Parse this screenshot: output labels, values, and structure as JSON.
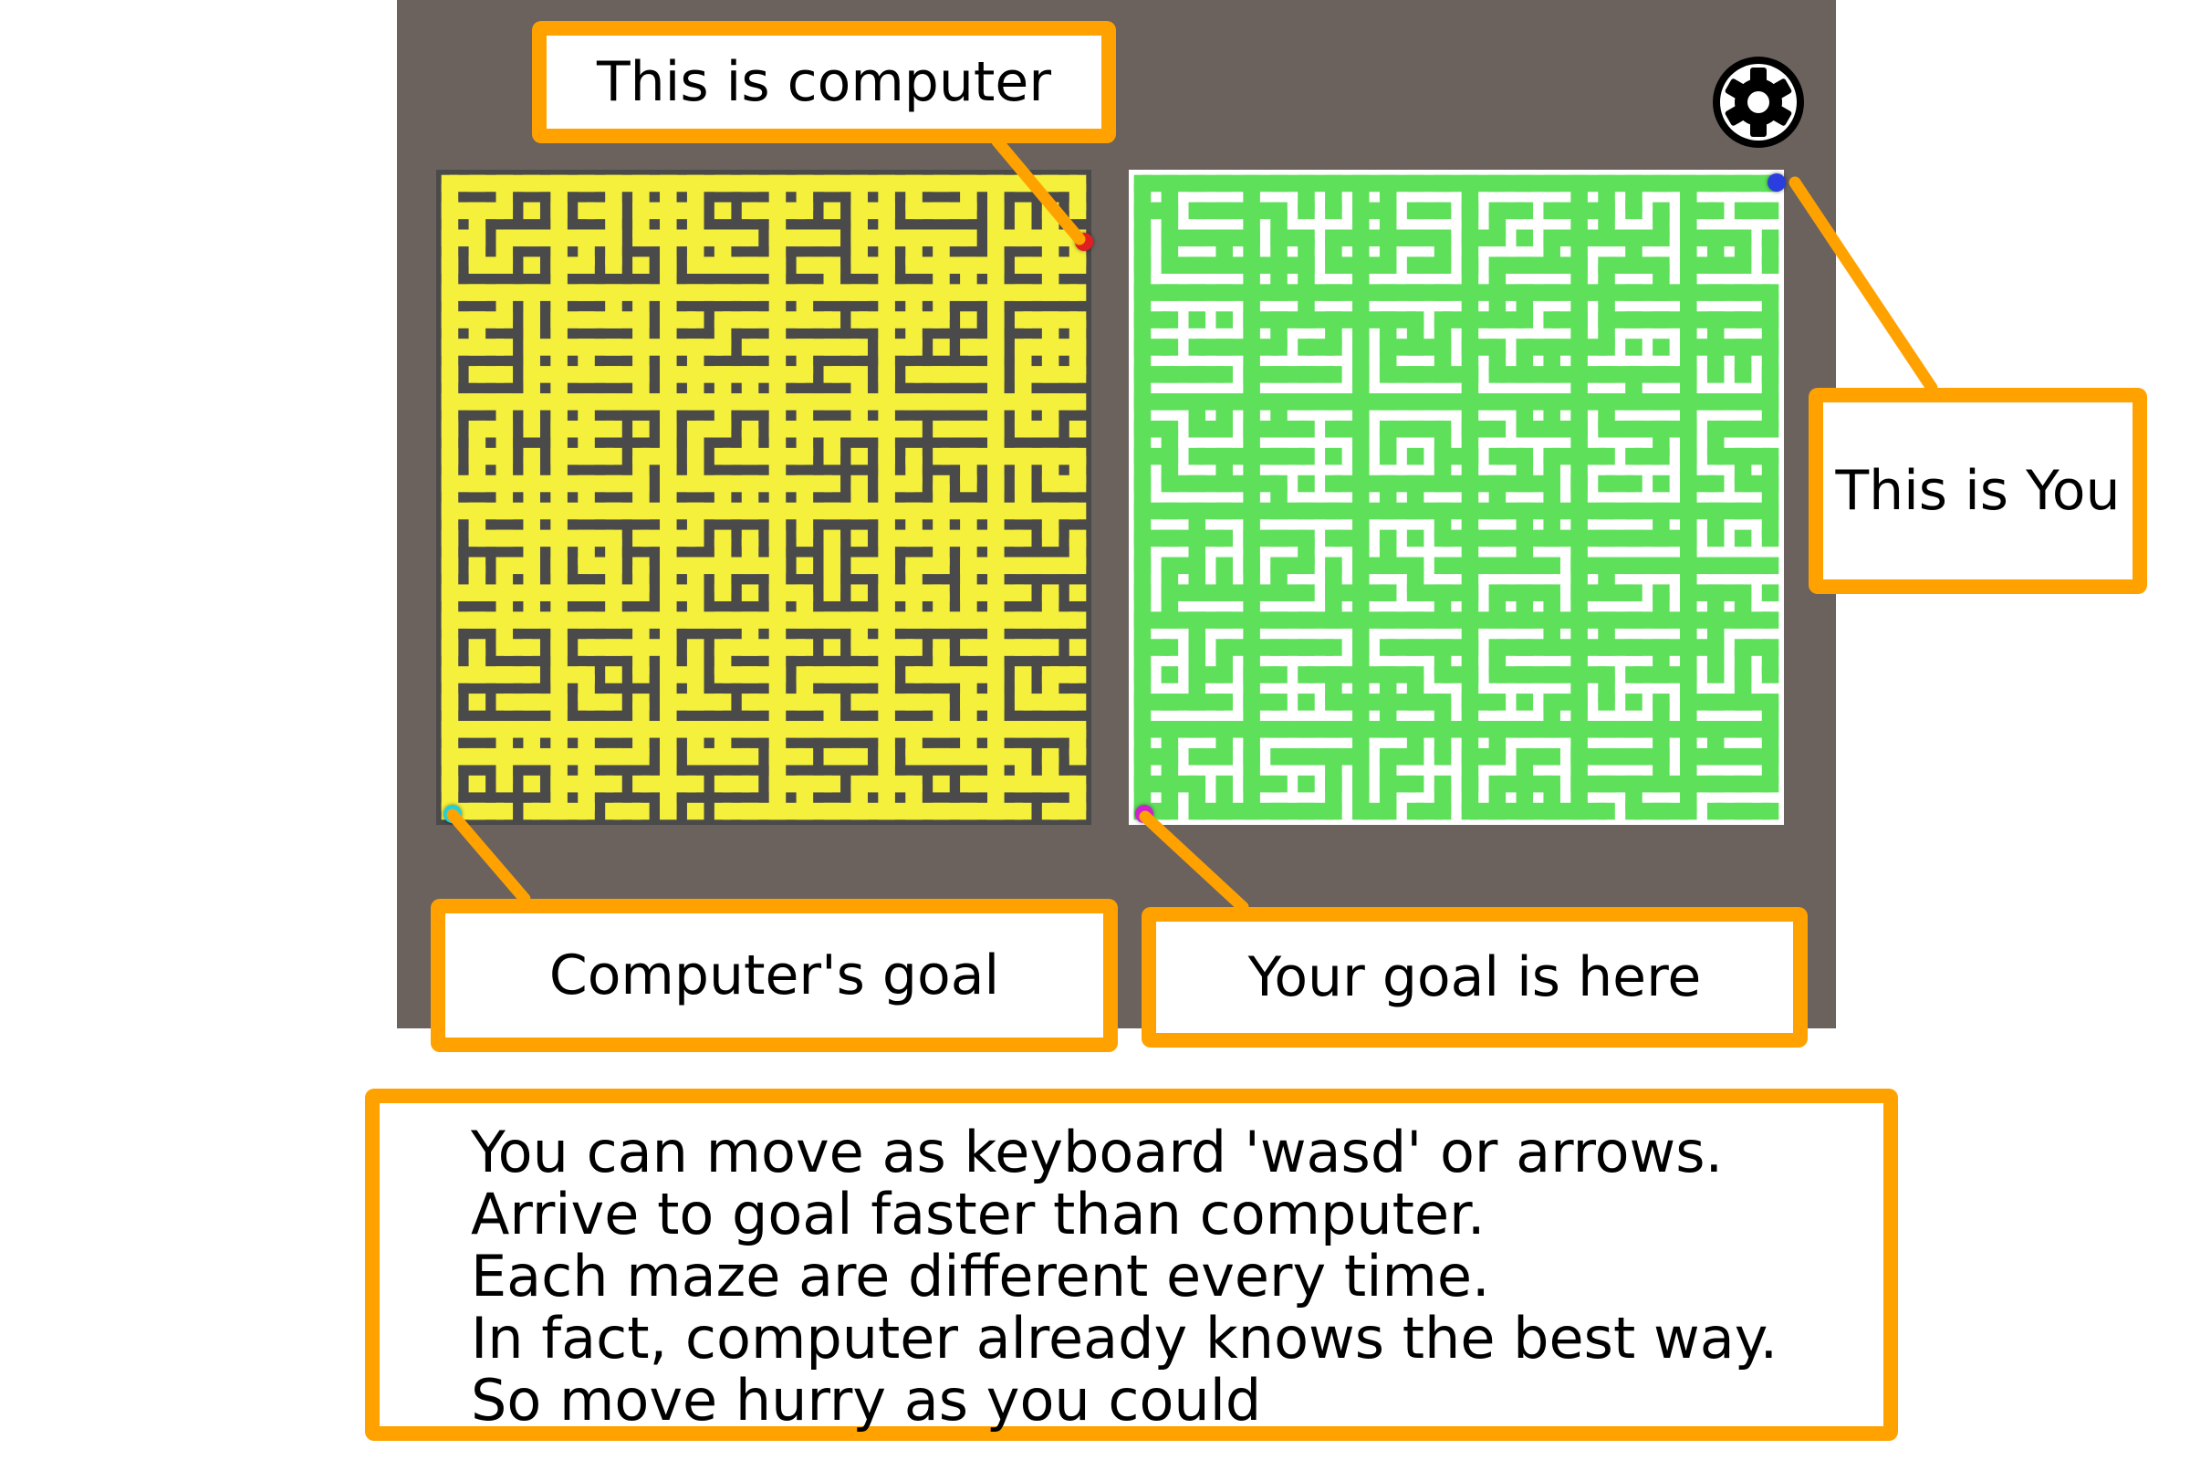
{
  "callouts": {
    "computer": "This is computer",
    "you": "This is You",
    "computer_goal": "Computer's goal",
    "your_goal": "Your goal is here"
  },
  "instructions": [
    "You can move as keyboard 'wasd' or arrows.",
    "Arrive to goal faster than computer.",
    "Each maze are different every time.",
    "In fact, computer already knows the best way.",
    "So move hurry as you could"
  ],
  "icons": {
    "settings": "gear-icon"
  },
  "colors": {
    "panel_background": "#6b625d",
    "computer_maze_path": "#f5f03c",
    "computer_maze_wall": "#4a4a4a",
    "player_maze_wall": "#5fe05a",
    "player_maze_path": "#ffffff",
    "callout_border": "#ffa200",
    "computer_marker": "#e02020",
    "player_marker": "#2a3ee0",
    "computer_goal_marker": "#20d0e0",
    "player_goal_marker": "#d020d0"
  }
}
